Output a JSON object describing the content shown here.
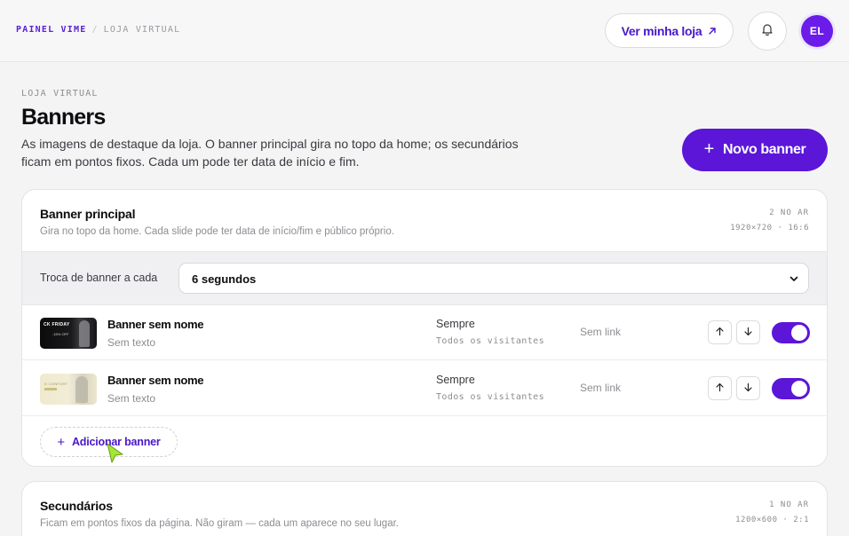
{
  "topbar": {
    "brand": "PAINEL VIME",
    "separator": "/",
    "section": "LOJA VIRTUAL",
    "store_button": "Ver minha loja",
    "store_button_icon": "arrow-up-right-icon",
    "bell_icon": "bell-icon",
    "avatar_initials": "EL"
  },
  "header": {
    "eyebrow": "LOJA VIRTUAL",
    "title": "Banners",
    "description": "As imagens de destaque da loja. O banner principal gira no topo da home; os secundários ficam em pontos fixos. Cada um pode ter data de início e fim.",
    "new_button": "Novo banner",
    "new_button_icon": "plus-icon"
  },
  "main_banner": {
    "title": "Banner principal",
    "subtitle": "Gira no topo da home. Cada slide pode ter data de início/fim e público próprio.",
    "status": "2 NO AR",
    "size": "1920×720 · 16:6",
    "rotation_label": "Troca de banner a cada",
    "rotation_value": "6 segundos",
    "items": [
      {
        "name": "Banner sem nome",
        "text": "Sem texto",
        "when": "Sempre",
        "audience": "Todos os visitantes",
        "link": "Sem link",
        "active": true,
        "thumb_text": "CK FRIDAY",
        "thumb_sub": "-15% OFF"
      },
      {
        "name": "Banner sem nome",
        "text": "Sem texto",
        "when": "Sempre",
        "audience": "Todos os visitantes",
        "link": "Sem link",
        "active": true,
        "thumb_text": "D CONFORT",
        "thumb_sub": ""
      }
    ],
    "add_button": "Adicionar banner"
  },
  "secondary_banner": {
    "title": "Secundários",
    "subtitle": "Ficam em pontos fixos da página. Não giram — cada um aparece no seu lugar.",
    "status": "1 NO AR",
    "size": "1200×600 · 2:1"
  },
  "colors": {
    "accent": "#5b16d8",
    "cursor": "#a3e635"
  }
}
